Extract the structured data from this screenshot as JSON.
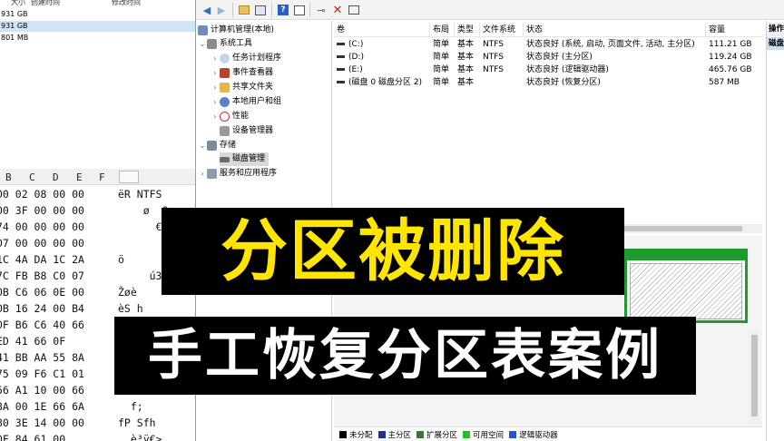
{
  "hex_editor": {
    "file_columns": [
      "大小",
      "创建时间",
      "修改时间"
    ],
    "file_rows": [
      {
        "size": "931 GB",
        "selected": false
      },
      {
        "size": "931 GB",
        "selected": true
      },
      {
        "size": "801 MB",
        "selected": false
      }
    ],
    "columns": [
      "B",
      "C",
      "D",
      "E",
      "F"
    ],
    "lines": [
      {
        "hex": "00 02 08 00 00",
        "ascii": "ëR NTFS"
      },
      {
        "hex": "00 3F 00 00 00",
        "ascii": "    ø  ?"
      },
      {
        "hex": "74 00 00 00 00",
        "ascii": "      € €"
      },
      {
        "hex": "07 00 00 00 00",
        "ascii": ""
      },
      {
        "hex": "1C 4A DA 1C 2A",
        "ascii": "ö"
      },
      {
        "hex": "7C FB B8 C0 07",
        "ascii": "     ú3ÀŽ"
      },
      {
        "hex": "0B C6 06 0E 00",
        "ascii": "Žøè"
      },
      {
        "hex": "0B 16 24 00 B4",
        "ascii": "èS h"
      },
      {
        "hex": "0F B6 C6 40 66",
        "ascii": ""
      },
      {
        "hex": "ED 41 66 0F",
        "ascii": ""
      },
      {
        "hex": "41 BB AA 55 8A",
        "ascii": ""
      },
      {
        "hex": "75 09 F6 C1 01",
        "ascii": ""
      },
      {
        "hex": "56 A1 10 00 66",
        "ascii": ""
      },
      {
        "hex": "8A 00 1E 66 6A",
        "ascii": "  f;"
      },
      {
        "hex": "80 3E 14 00 00",
        "ascii": "fP Sfh"
      },
      {
        "hex": "0F 84 61 00",
        "ascii": "  è³ÿ€>"
      }
    ]
  },
  "mmc": {
    "tree": {
      "root": "计算机管理(本地)",
      "system_tools": "系统工具",
      "task_scheduler": "任务计划程序",
      "event_viewer": "事件查看器",
      "shared_folders": "共享文件夹",
      "local_users": "本地用户和组",
      "performance": "性能",
      "device_manager": "设备管理器",
      "storage": "存储",
      "disk_management": "磁盘管理",
      "services_apps": "服务和应用程序"
    },
    "list": {
      "headers": [
        "卷",
        "布局",
        "类型",
        "文件系统",
        "状态",
        "容量"
      ],
      "rows": [
        {
          "volume": "(C:)",
          "layout": "简单",
          "type": "基本",
          "fs": "NTFS",
          "status": "状态良好 (系统, 启动, 页面文件, 活动, 主分区)",
          "capacity": "111.21 GB"
        },
        {
          "volume": "(D:)",
          "layout": "简单",
          "type": "基本",
          "fs": "NTFS",
          "status": "状态良好 (主分区)",
          "capacity": "119.24 GB"
        },
        {
          "volume": "(E:)",
          "layout": "简单",
          "type": "基本",
          "fs": "NTFS",
          "status": "状态良好 (逻辑驱动器)",
          "capacity": "465.76 GB"
        },
        {
          "volume": "(磁盘 0 磁盘分区 2)",
          "layout": "简单",
          "type": "基本",
          "fs": "",
          "status": "状态良好 (恢复分区)",
          "capacity": "587 MB"
        }
      ]
    },
    "actions": {
      "header": "操作",
      "item": "磁盘"
    },
    "legend": [
      {
        "label": "未分配",
        "color": "#000000"
      },
      {
        "label": "主分区",
        "color": "#1c2f9e"
      },
      {
        "label": "扩展分区",
        "color": "#2e7d32"
      },
      {
        "label": "可用空间",
        "color": "#21c321"
      },
      {
        "label": "逻辑驱动器",
        "color": "#2a4fd8"
      }
    ]
  },
  "overlay": {
    "title": "分区被删除",
    "subtitle": "手工恢复分区表案例",
    "title_color": "#ffe600",
    "subtitle_color": "#ffffff"
  }
}
